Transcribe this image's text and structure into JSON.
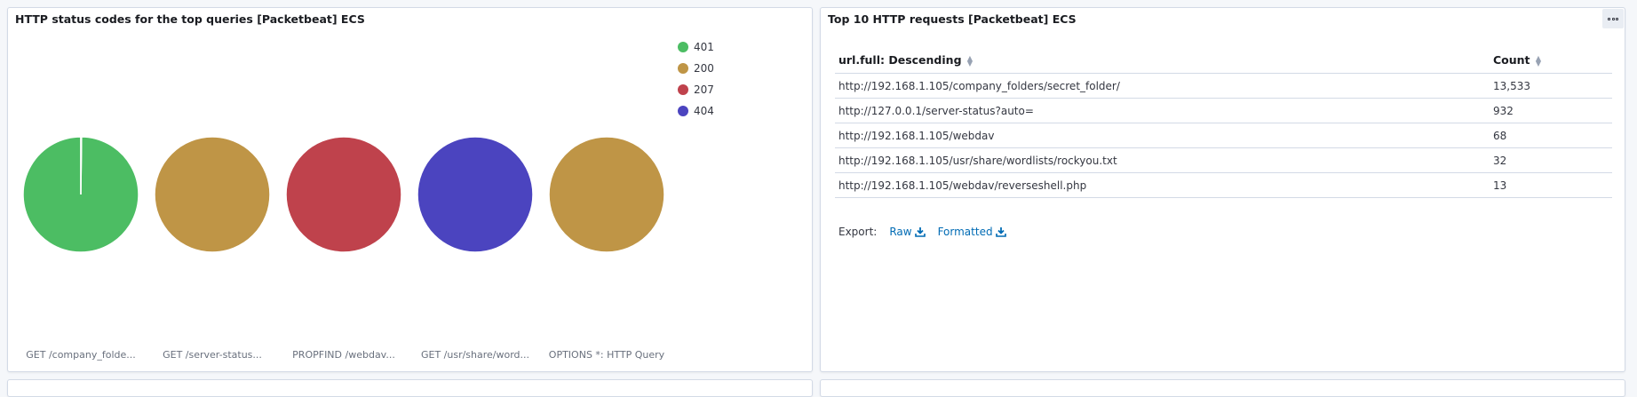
{
  "colors": {
    "401": "#4cbd63",
    "200": "#bf9546",
    "207": "#bf424c",
    "404": "#4b44bf"
  },
  "left_panel": {
    "title": "HTTP status codes for the top queries [Packetbeat] ECS",
    "legend": [
      "401",
      "200",
      "207",
      "404"
    ],
    "pies": [
      {
        "label": "GET /company_folde...",
        "status": "401"
      },
      {
        "label": "GET /server-status...",
        "status": "200"
      },
      {
        "label": "PROPFIND /webdav...",
        "status": "207"
      },
      {
        "label": "GET /usr/share/word...",
        "status": "404"
      },
      {
        "label": "OPTIONS *: HTTP Query",
        "status": "200"
      }
    ]
  },
  "right_panel": {
    "title": "Top 10 HTTP requests [Packetbeat] ECS",
    "columns": [
      "url.full: Descending",
      "Count"
    ],
    "rows": [
      {
        "url": "http://192.168.1.105/company_folders/secret_folder/",
        "count": "13,533"
      },
      {
        "url": "http://127.0.0.1/server-status?auto=",
        "count": "932"
      },
      {
        "url": "http://192.168.1.105/webdav",
        "count": "68"
      },
      {
        "url": "http://192.168.1.105/usr/share/wordlists/rockyou.txt",
        "count": "32"
      },
      {
        "url": "http://192.168.1.105/webdav/reverseshell.php",
        "count": "13"
      }
    ],
    "export_label": "Export:",
    "export_raw": "Raw",
    "export_formatted": "Formatted"
  },
  "chart_data": {
    "type": "pie",
    "legend": [
      "401",
      "200",
      "207",
      "404"
    ],
    "series": [
      {
        "name": "GET /company_folde...",
        "slices": [
          {
            "label": "401",
            "value": 99.8
          },
          {
            "label": "200",
            "value": 0.2
          }
        ]
      },
      {
        "name": "GET /server-status...",
        "slices": [
          {
            "label": "200",
            "value": 100
          }
        ]
      },
      {
        "name": "PROPFIND /webdav...",
        "slices": [
          {
            "label": "207",
            "value": 100
          }
        ]
      },
      {
        "name": "GET /usr/share/word...",
        "slices": [
          {
            "label": "404",
            "value": 100
          }
        ]
      },
      {
        "name": "OPTIONS *: HTTP Query",
        "slices": [
          {
            "label": "200",
            "value": 100
          }
        ]
      }
    ]
  }
}
